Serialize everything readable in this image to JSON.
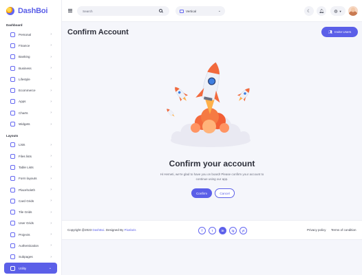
{
  "app": {
    "logo_text": "DashBoi"
  },
  "sidebar": {
    "sections": [
      {
        "title": "Dashboard",
        "items": [
          {
            "label": "Personal",
            "icon": "home-icon"
          },
          {
            "label": "Finance",
            "icon": "finance-icon"
          },
          {
            "label": "Banking",
            "icon": "banking-icon"
          },
          {
            "label": "Business",
            "icon": "business-icon"
          },
          {
            "label": "Lifestyle",
            "icon": "lifestyle-icon"
          },
          {
            "label": "Ecommerce",
            "icon": "ecommerce-icon"
          },
          {
            "label": "Apps",
            "icon": "apps-icon"
          },
          {
            "label": "Charts",
            "icon": "charts-icon"
          },
          {
            "label": "Widgets",
            "icon": "widgets-icon"
          }
        ]
      },
      {
        "title": "Layouts",
        "items": [
          {
            "label": "Lists",
            "icon": "lists-icon"
          },
          {
            "label": "Files lists",
            "icon": "files-icon"
          },
          {
            "label": "Table Lists",
            "icon": "table-icon"
          },
          {
            "label": "Form layouts",
            "icon": "form-icon"
          },
          {
            "label": "Placeholeth",
            "icon": "placeholder-icon"
          },
          {
            "label": "Card Grids",
            "icon": "card-icon"
          },
          {
            "label": "Tile Grids",
            "icon": "tile-icon"
          },
          {
            "label": "User Grids",
            "icon": "user-grid-icon"
          },
          {
            "label": "Projects",
            "icon": "projects-icon"
          },
          {
            "label": "Authentication",
            "icon": "auth-icon"
          },
          {
            "label": "Subpages",
            "icon": "subpages-icon"
          },
          {
            "label": "Utility",
            "icon": "utility-icon",
            "active": true
          }
        ]
      }
    ]
  },
  "topbar": {
    "search_placeholder": "Search",
    "layout_mode": "Vertical",
    "icons": [
      "menu-icon",
      "search-icon",
      "moon-icon",
      "bell-icon",
      "globe-icon"
    ]
  },
  "main": {
    "page_title": "Confirm Account",
    "invite_label": "Invite Users",
    "card_title": "Confirm your account",
    "card_text": "Hi Hemeti, we're glad to have you on board! Please confirm your account to continue using our app.",
    "confirm_label": "Confirm",
    "cancel_label": "Cancel"
  },
  "footer": {
    "copyright_prefix": "Copyright @2023",
    "brand": "DashBoi",
    "designed_by": ". Designed By",
    "designer": "Pixelaris",
    "socials": [
      "f",
      "t",
      "in",
      "ig",
      "yt"
    ],
    "privacy": "Privacy policy",
    "terms": "Terms of condition"
  },
  "colors": {
    "accent": "#5b5fe8",
    "background": "#f5f6fb",
    "surface": "#ffffff"
  }
}
